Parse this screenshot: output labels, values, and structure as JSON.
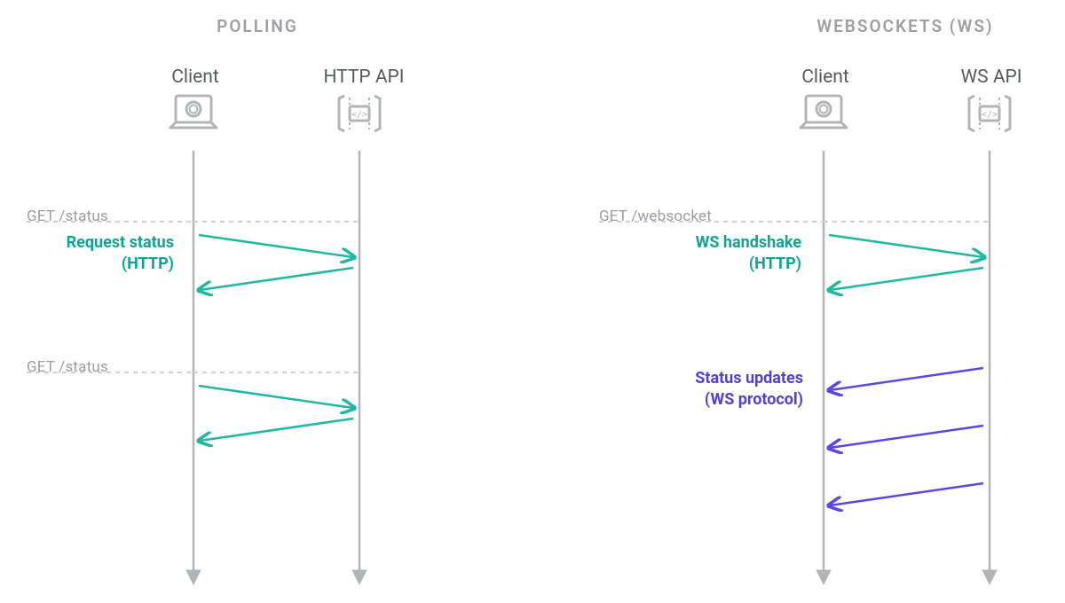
{
  "left": {
    "section_title": "POLLING",
    "client_label": "Client",
    "api_label": "HTTP API",
    "route1": "GET /status",
    "msg1_line1": "Request status",
    "msg1_line2": "(HTTP)",
    "route2": "GET /status"
  },
  "right": {
    "section_title": "WEBSOCKETS (WS)",
    "client_label": "Client",
    "api_label": "WS API",
    "route1": "GET /websocket",
    "msg1_line1": "WS handshake",
    "msg1_line2": "(HTTP)",
    "msg2_line1": "Status updates",
    "msg2_line2": "(WS protocol)"
  },
  "colors": {
    "teal": "#21b8a2",
    "purple": "#5a48e2",
    "lifeline": "#b3b4b7",
    "dashed": "#cfd0d3",
    "icon": "#b3b4b7"
  }
}
